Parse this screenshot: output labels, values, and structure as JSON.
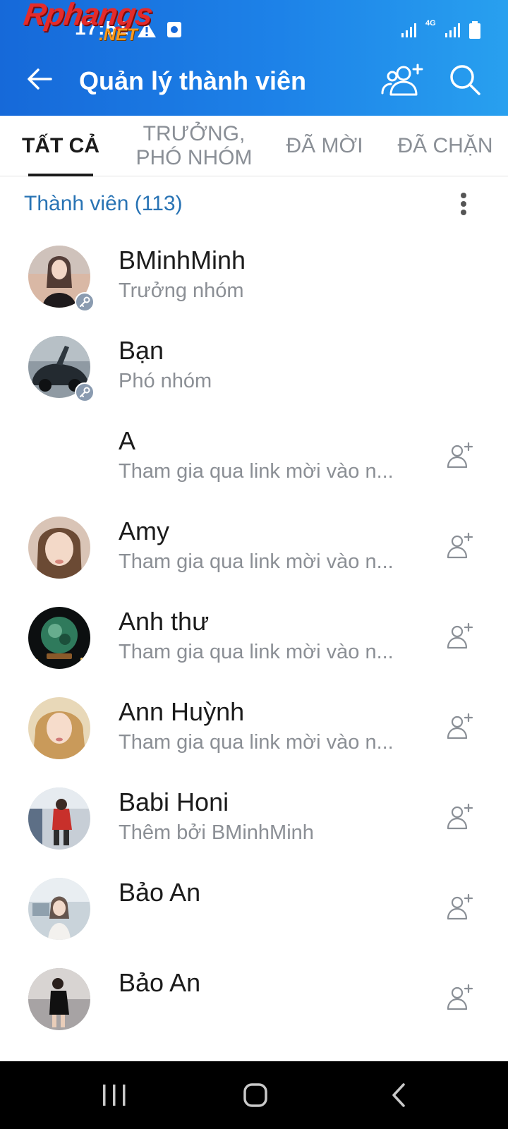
{
  "status_bar": {
    "time": "17:51",
    "network": "4G"
  },
  "header": {
    "title": "Quản lý thành viên"
  },
  "watermark": {
    "main": "Rphangs",
    "sub": ".NET"
  },
  "tabs": [
    {
      "label": "TẤT CẢ",
      "active": true
    },
    {
      "label": "TRƯỞNG, PHÓ NHÓM",
      "active": false
    },
    {
      "label": "ĐÃ MỜI",
      "active": false
    },
    {
      "label": "ĐÃ CHẶN",
      "active": false
    }
  ],
  "section": {
    "title": "Thành viên (113)"
  },
  "members": [
    {
      "name": "BMinhMinh",
      "subtitle": "Trưởng nhóm",
      "badge": "key-icon",
      "avatar_color": "#c9a08a"
    },
    {
      "name": "Bạn",
      "subtitle": "Phó nhóm",
      "badge": "key-icon",
      "avatar_color": "#3d4a55"
    },
    {
      "name": "A",
      "subtitle": "Tham gia qua link mời vào n...",
      "add_friend": true,
      "avatar_color": "#ffffff"
    },
    {
      "name": "Amy",
      "subtitle": "Tham gia qua link mời vào n...",
      "add_friend": true,
      "avatar_color": "#d8b7a4"
    },
    {
      "name": "Anh thư",
      "subtitle": "Tham gia qua link mời vào n...",
      "add_friend": true,
      "avatar_color": "#1f4d3c"
    },
    {
      "name": "Ann Huỳnh",
      "subtitle": "Tham gia qua link mời vào n...",
      "add_friend": true,
      "avatar_color": "#e2c08c"
    },
    {
      "name": "Babi Honi",
      "subtitle": "Thêm bởi BMinhMinh",
      "add_friend": true,
      "avatar_color": "#8e98a6"
    },
    {
      "name": "Bảo An",
      "subtitle": "",
      "add_friend": true,
      "avatar_color": "#b9c3cc"
    },
    {
      "name": "Bảo An",
      "subtitle": "",
      "add_friend": true,
      "avatar_color": "#6f6b6d"
    }
  ],
  "colors": {
    "header_start": "#1669d9",
    "header_end": "#28a0ef",
    "section_title": "#2873b4"
  }
}
